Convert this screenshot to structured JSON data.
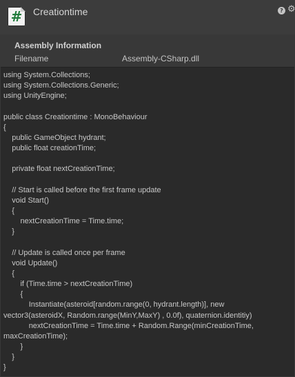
{
  "header": {
    "title": "Creationtime",
    "script_icon": "script-hash-icon",
    "help_icon": "help-icon",
    "settings_icon": "settings-gear-icon"
  },
  "assembly": {
    "heading": "Assembly Information",
    "filename_label": "Filename",
    "filename_value": "Assembly-CSharp.dll"
  },
  "code": {
    "text": "using System.Collections;\nusing System.Collections.Generic;\nusing UnityEngine;\n\npublic class Creationtime : MonoBehaviour\n{\n    public GameObject hydrant;\n    public float creationTime;\n\n    private float nextCreationTime;\n\n    // Start is called before the first frame update\n    void Start()\n    {\n        nextCreationTime = Time.time;\n    }\n\n    // Update is called once per frame\n    void Update()\n    {\n        if (Time.time > nextCreationTime)\n        {\n            Instantiate(asteroid[random.range(0, hydrant.length)], new\nvector3(asteroidX, Random.range(MinY,MaxY) , 0.0f), quaternion.identitiy)\n            nextCreationTime = Time.time + Random.Range(minCreationTime,\nmaxCreationTime);\n        }\n    }\n}"
  },
  "colors": {
    "background": "#383838",
    "code_background": "#2a2a2a",
    "script_icon_green": "#1f7a3a"
  }
}
